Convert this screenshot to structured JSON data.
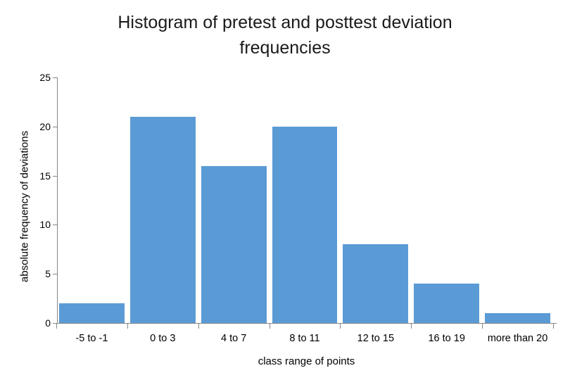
{
  "chart_data": {
    "type": "bar",
    "title": "Histogram of pretest and posttest deviation frequencies",
    "title_line1": "Histogram of pretest and posttest deviation",
    "title_line2": "frequencies",
    "xlabel": "class range of points",
    "ylabel": "absolute frequency of deviations",
    "categories": [
      "-5 to -1",
      "0 to 3",
      "4 to 7",
      "8 to 11",
      "12 to 15",
      "16 to 19",
      "more than 20"
    ],
    "values": [
      2,
      21,
      16,
      20,
      8,
      4,
      1
    ],
    "ylim": [
      0,
      25
    ],
    "ytick_values": [
      0,
      5,
      10,
      15,
      20,
      25
    ],
    "ytick_labels": [
      "0",
      "5",
      "10",
      "15",
      "20",
      "25"
    ],
    "grid": false,
    "legend": false,
    "bar_color": "#5B9BD5",
    "axis_color": "#868686",
    "background_color": "#FFFFFF",
    "text_color": "#000000"
  }
}
